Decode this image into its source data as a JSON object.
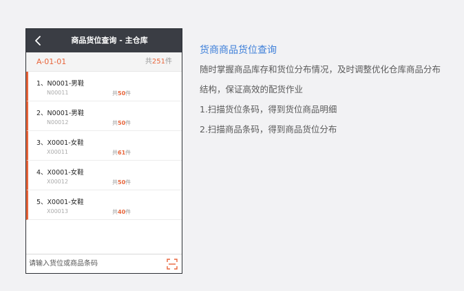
{
  "phone": {
    "nav": {
      "back_icon": "chevron-left-icon",
      "title": "商品货位查询 - 主仓库"
    },
    "location": {
      "code": "A-01-01",
      "total_prefix": "共",
      "total_num": "251",
      "total_suffix": "件"
    },
    "items": [
      {
        "title": "1、N0001-男鞋",
        "code": "N00011",
        "count_prefix": "共",
        "count": "50",
        "count_suffix": "件"
      },
      {
        "title": "2、N0001-男鞋",
        "code": "N00012",
        "count_prefix": "共",
        "count": "50",
        "count_suffix": "件"
      },
      {
        "title": "3、X0001-女鞋",
        "code": "X00011",
        "count_prefix": "共",
        "count": "61",
        "count_suffix": "件"
      },
      {
        "title": "4、X0001-女鞋",
        "code": "X00012",
        "count_prefix": "共",
        "count": "50",
        "count_suffix": "件"
      },
      {
        "title": "5、X0001-女鞋",
        "code": "X00013",
        "count_prefix": "共",
        "count": "40",
        "count_suffix": "件"
      }
    ],
    "search": {
      "placeholder": "请输入货位或商品条码",
      "value": "",
      "scan_icon": "scan-icon"
    }
  },
  "description": {
    "title": "货商商品货位查询",
    "lines": [
      "随时掌握商品库存和货位分布情况，及时调整优化仓库商品分布结构，保证高效的配货作业",
      "1.扫描货位条码，得到货位商品明细",
      "2.扫描商品条码，得到商品货位分布"
    ]
  },
  "colors": {
    "accent": "#e8643a",
    "nav_bg": "#3a3d44",
    "title_blue": "#3d7fd9",
    "page_bg": "#f2f2f4"
  }
}
